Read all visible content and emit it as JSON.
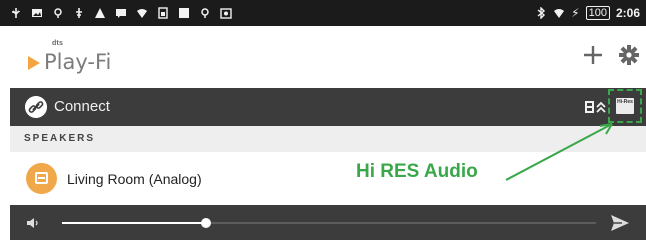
{
  "status_bar": {
    "left_icons": [
      "usb-icon",
      "image-icon",
      "location-icon",
      "usb-debug-icon",
      "warning-icon",
      "message-icon",
      "wifi-icon",
      "sim-icon",
      "stop-icon",
      "location-icon",
      "photo-icon"
    ],
    "battery": "100",
    "time": "2:06"
  },
  "header": {
    "logo_brand": "dts",
    "logo_text": "Play-Fi",
    "add_icon": "plus-icon",
    "settings_icon": "gear-icon"
  },
  "connect_bar": {
    "label": "Connect",
    "hires_badge": "Hi-Res"
  },
  "speakers": {
    "section_label": "SPEAKERS",
    "items": [
      {
        "name": "Living Room (Analog)"
      }
    ]
  },
  "annotation": {
    "label": "Hi RES Audio",
    "color": "#3aa84a"
  },
  "player": {
    "volume_level": 0.27
  },
  "colors": {
    "accent": "#f0a84a",
    "bar": "#3c3c3c",
    "status_bar": "#1b1b1b"
  }
}
